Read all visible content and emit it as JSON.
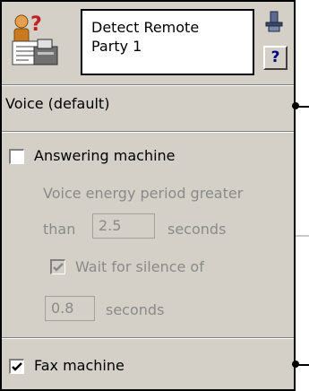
{
  "header": {
    "title_line1": "Detect Remote",
    "title_line2": "Party 1",
    "help_label": "?"
  },
  "voice_label": "Voice (default)",
  "answering": {
    "label": "Answering machine",
    "checked": false,
    "desc_line1": "Voice energy period greater",
    "desc_than": "than",
    "period_value": "2.5",
    "period_unit": "seconds",
    "wait_label": "Wait for silence of",
    "wait_checked": true,
    "silence_value": "0.8",
    "silence_unit": "seconds"
  },
  "fax": {
    "label": "Fax machine",
    "checked": true
  },
  "colors": {
    "panel": "#d4d0c8",
    "disabled_text": "#8a8a8a",
    "help_mark": "#000080"
  }
}
